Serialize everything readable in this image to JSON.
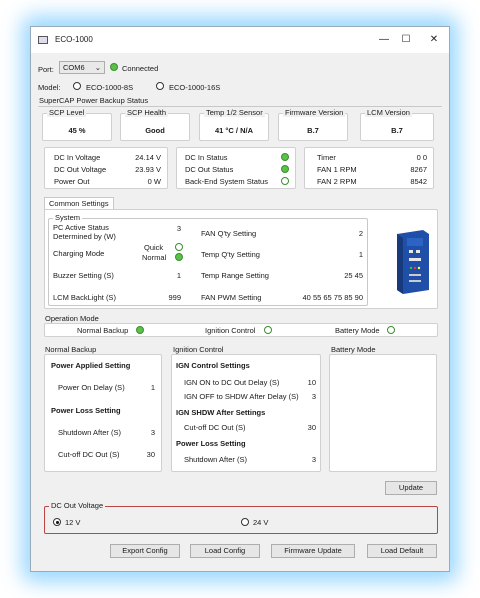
{
  "window": {
    "title": "ECO-1000",
    "minimize": "—",
    "maximize": "☐",
    "close": "✕"
  },
  "port": {
    "label": "Port:",
    "value": "COM6",
    "status": "Connected"
  },
  "model": {
    "label": "Model:",
    "options": [
      "ECO-1000-8S",
      "ECO-1000-16S"
    ]
  },
  "supercap": {
    "title": "SuperCAP Power Backup Status",
    "scp_level": {
      "label": "SCP Level",
      "value": "45 %"
    },
    "scp_health": {
      "label": "SCP Health",
      "value": "Good"
    },
    "temp": {
      "label": "Temp 1/2 Sensor",
      "value": "41 °C / N/A"
    },
    "firmware": {
      "label": "Firmware Version",
      "value": "B.7"
    },
    "lcm": {
      "label": "LCM Version",
      "value": "B.7"
    },
    "dc": {
      "in_voltage_label": "DC In Voltage",
      "in_voltage": "24.14 V",
      "out_voltage_label": "DC Out Voltage",
      "out_voltage": "23.93 V",
      "power_out_label": "Power Out",
      "power_out": "0 W"
    },
    "status": {
      "dc_in": "DC In Status",
      "dc_out": "DC Out Status",
      "backend": "Back-End System Status"
    },
    "timer": {
      "timer_label": "Timer",
      "timer_value": "0 0",
      "fan1_label": "FAN 1 RPM",
      "fan1_value": "8267",
      "fan2_label": "FAN 2 RPM",
      "fan2_value": "8542"
    }
  },
  "common": {
    "tab": "Common Settings",
    "system": "System",
    "pc_active_label": "PC Active Status Determined by (W)",
    "pc_active_value": "3",
    "charging_label": "Charging Mode",
    "quick": "Quick",
    "normal": "Normal",
    "buzzer_label": "Buzzer Setting (S)",
    "buzzer_value": "1",
    "lcm_backlight_label": "LCM BackLight (S)",
    "lcm_backlight_value": "999",
    "fan_qty_label": "FAN Q'ty Setting",
    "fan_qty_value": "2",
    "temp_qty_label": "Temp Q'ty Setting",
    "temp_qty_value": "1",
    "temp_range_label": "Temp Range Setting",
    "temp_range_value": "25 45",
    "fan_pwm_label": "FAN PWM Setting",
    "fan_pwm_value": "40 55 65 75 85 90"
  },
  "operation": {
    "title": "Operation Mode",
    "normal_backup": "Normal Backup",
    "ignition": "Ignition Control",
    "battery": "Battery Mode"
  },
  "normal_backup": {
    "title": "Normal Backup",
    "power_applied": "Power Applied Setting",
    "power_on_delay_label": "Power On Delay (S)",
    "power_on_delay_value": "1",
    "power_loss": "Power Loss Setting",
    "shutdown_after_label": "Shutdown After (S)",
    "shutdown_after_value": "3",
    "cutoff_label": "Cut-off DC Out (S)",
    "cutoff_value": "30"
  },
  "ignition": {
    "title": "Ignition Control",
    "ign_control": "IGN Control Settings",
    "ign_on_label": "IGN ON to DC Out Delay (S)",
    "ign_on_value": "10",
    "ign_off_label": "IGN OFF to SHDW After Delay (S)",
    "ign_off_value": "3",
    "ign_shdw": "IGN SHDW After Settings",
    "cutoff_label": "Cut-off DC Out (S)",
    "cutoff_value": "30",
    "power_loss": "Power Loss Setting",
    "shutdown_label": "Shutdown After (S)",
    "shutdown_value": "3"
  },
  "battery": {
    "title": "Battery Mode"
  },
  "update_button": "Update",
  "dc_out_voltage": {
    "title": "DC Out Voltage",
    "opt1": "12 V",
    "opt2": "24 V"
  },
  "buttons": {
    "export": "Export Config",
    "load": "Load Config",
    "firmware": "Firmware Update",
    "default": "Load Default"
  }
}
